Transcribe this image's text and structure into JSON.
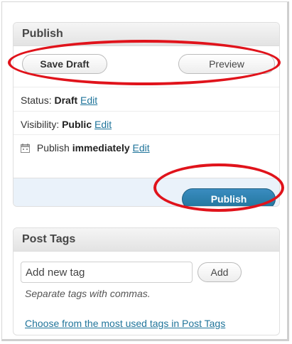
{
  "publish_box": {
    "title": "Publish",
    "save_draft_label": "Save Draft",
    "preview_label": "Preview",
    "status": {
      "label": "Status:",
      "value": "Draft",
      "edit": "Edit"
    },
    "visibility": {
      "label": "Visibility:",
      "value": "Public",
      "edit": "Edit"
    },
    "schedule": {
      "label": "Publish",
      "value": "immediately",
      "edit": "Edit"
    },
    "publish_label": "Publish"
  },
  "tags_box": {
    "title": "Post Tags",
    "input_placeholder": "Add new tag",
    "add_label": "Add",
    "hint": "Separate tags with commas.",
    "most_used_link": "Choose from the most used tags in Post Tags"
  },
  "colors": {
    "annotation_red": "#e0131b",
    "link_blue": "#21759b",
    "publish_button": "#21759b",
    "actions_bg": "#eaf2fa"
  }
}
